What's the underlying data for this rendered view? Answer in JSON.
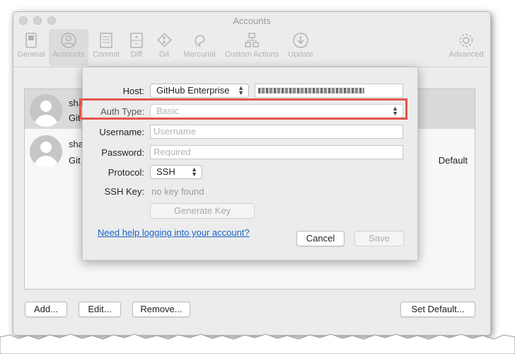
{
  "window": {
    "title": "Accounts"
  },
  "toolbar": {
    "items": [
      {
        "label": "General",
        "icon": "switch-icon"
      },
      {
        "label": "Accounts",
        "icon": "account-icon"
      },
      {
        "label": "Commit",
        "icon": "document-icon"
      },
      {
        "label": "Diff",
        "icon": "diff-icon"
      },
      {
        "label": "Git",
        "icon": "git-icon"
      },
      {
        "label": "Mercurial",
        "icon": "mercurial-icon"
      },
      {
        "label": "Custom Actions",
        "icon": "custom-actions-icon"
      },
      {
        "label": "Update",
        "icon": "download-icon"
      },
      {
        "label": "Advanced",
        "icon": "gear-icon"
      }
    ],
    "active": "Accounts"
  },
  "accounts_list": {
    "rows": [
      {
        "line1": "sha",
        "line2": "Git",
        "selected": true,
        "default": ""
      },
      {
        "line1": "sha",
        "line2": "Git",
        "selected": false,
        "default": "Default"
      }
    ]
  },
  "bottom_buttons": {
    "add": "Add...",
    "edit": "Edit...",
    "remove": "Remove...",
    "set_default": "Set Default..."
  },
  "sheet": {
    "host_label": "Host:",
    "host_value": "GitHub Enterprise",
    "auth_label": "Auth Type:",
    "auth_value": "Basic",
    "username_label": "Username:",
    "username_placeholder": "Username",
    "password_label": "Password:",
    "password_placeholder": "Required",
    "protocol_label": "Protocol:",
    "protocol_value": "SSH",
    "ssh_key_label": "SSH Key:",
    "ssh_key_value": "no key found",
    "generate_key": "Generate Key",
    "help_link": "Need help logging into your account?",
    "cancel": "Cancel",
    "save": "Save"
  },
  "colors": {
    "highlight": "#e2564c",
    "link": "#1a63c8"
  }
}
